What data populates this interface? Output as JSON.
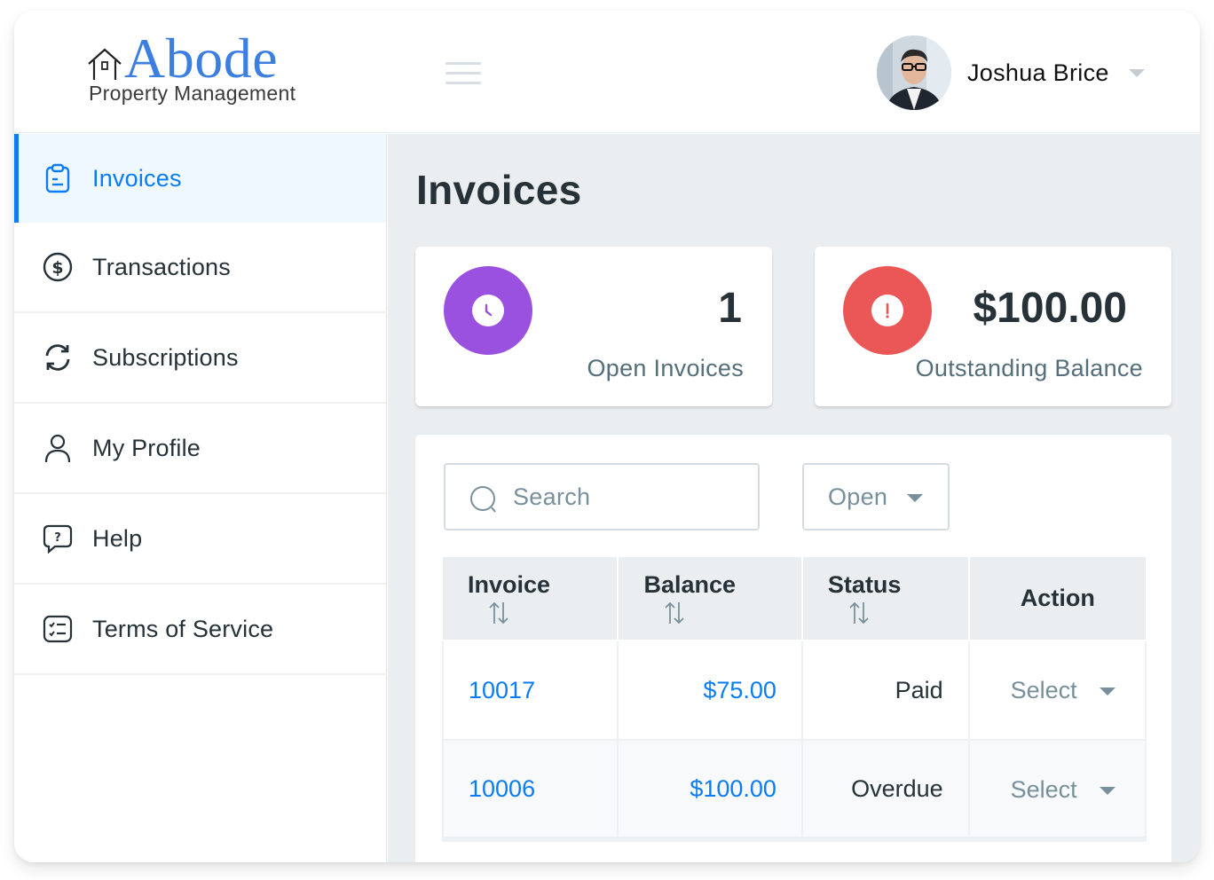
{
  "header": {
    "logo_word": "Abode",
    "logo_subtitle": "Property Management",
    "user_name": "Joshua Brice"
  },
  "sidebar": {
    "items": [
      {
        "label": "Invoices",
        "icon": "clipboard-icon",
        "active": true
      },
      {
        "label": "Transactions",
        "icon": "dollar-circle-icon",
        "active": false
      },
      {
        "label": "Subscriptions",
        "icon": "refresh-icon",
        "active": false
      },
      {
        "label": "My Profile",
        "icon": "user-icon",
        "active": false
      },
      {
        "label": "Help",
        "icon": "help-bubble-icon",
        "active": false
      },
      {
        "label": "Terms of Service",
        "icon": "checklist-icon",
        "active": false
      }
    ]
  },
  "main": {
    "title": "Invoices",
    "stats": [
      {
        "value": "1",
        "label": "Open Invoices",
        "icon": "clock-icon",
        "color": "#9b51e0"
      },
      {
        "value": "$100.00",
        "label": "Outstanding Balance",
        "icon": "alert-icon",
        "color": "#eb5757"
      }
    ],
    "search": {
      "placeholder": "Search"
    },
    "status_filter": {
      "selected": "Open"
    },
    "table": {
      "columns": [
        "Invoice",
        "Balance",
        "Status",
        "Action"
      ],
      "rows": [
        {
          "invoice": "10017",
          "balance": "$75.00",
          "status": "Paid",
          "action": "Select"
        },
        {
          "invoice": "10006",
          "balance": "$100.00",
          "status": "Overdue",
          "action": "Select"
        }
      ]
    }
  },
  "colors": {
    "accent": "#0a7cf5",
    "logo_blue": "#3d7fe0",
    "text_dark": "#263238",
    "text_muted": "#78909c",
    "purple": "#9b51e0",
    "red": "#eb5757"
  }
}
